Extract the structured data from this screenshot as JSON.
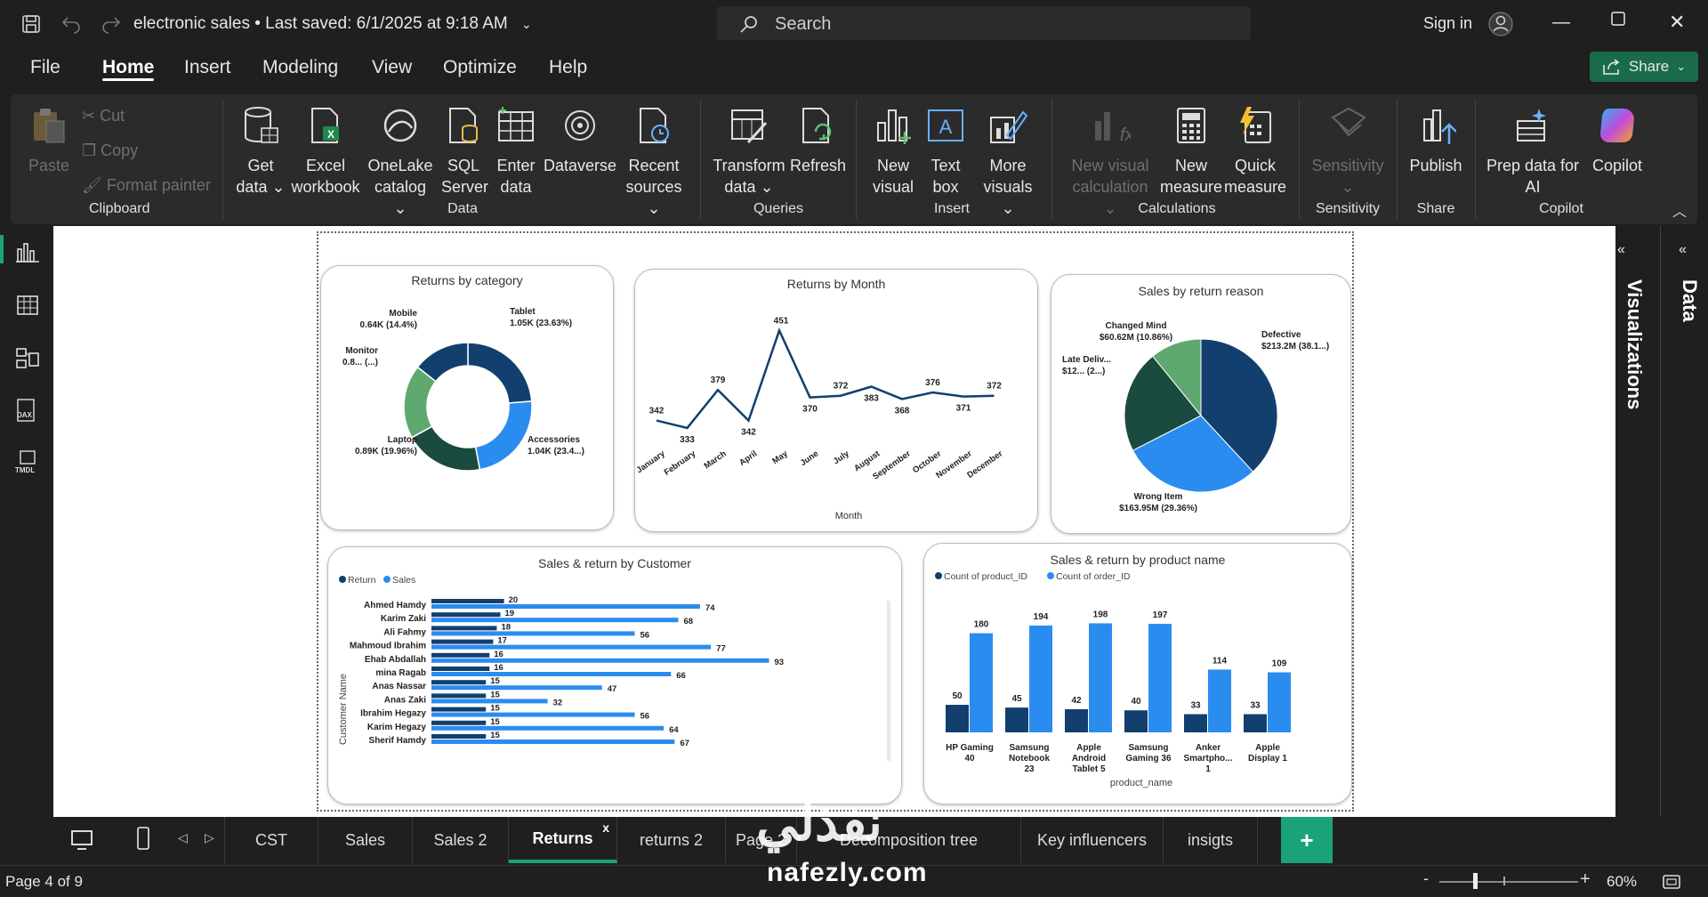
{
  "titlebar": {
    "doc_title": "electronic sales",
    "saved_text": "Last saved: 6/1/2025 at 9:18 AM",
    "search_placeholder": "Search",
    "signin": "Sign in"
  },
  "menu": [
    "File",
    "Home",
    "Insert",
    "Modeling",
    "View",
    "Optimize",
    "Help"
  ],
  "share_label": "Share",
  "ribbon": {
    "clipboard": {
      "paste": "Paste",
      "cut": "Cut",
      "copy": "Copy",
      "format_painter": "Format painter",
      "group": "Clipboard"
    },
    "data": {
      "get_data": [
        "Get",
        "data"
      ],
      "excel": [
        "Excel",
        "workbook"
      ],
      "onelake": [
        "OneLake",
        "catalog"
      ],
      "sql": [
        "SQL",
        "Server"
      ],
      "enter": [
        "Enter",
        "data"
      ],
      "dataverse": "Dataverse",
      "recent": [
        "Recent",
        "sources"
      ],
      "group": "Data"
    },
    "queries": {
      "transform": [
        "Transform",
        "data"
      ],
      "refresh": "Refresh",
      "group": "Queries"
    },
    "insert": {
      "new_visual": [
        "New",
        "visual"
      ],
      "text_box": [
        "Text",
        "box"
      ],
      "more_visuals": [
        "More",
        "visuals"
      ],
      "group": "Insert"
    },
    "calculations": {
      "new_visual_calc": [
        "New visual",
        "calculation"
      ],
      "new_measure": [
        "New",
        "measure"
      ],
      "quick_measure": [
        "Quick",
        "measure"
      ],
      "group": "Calculations"
    },
    "sensitivity": {
      "btn": "Sensitivity",
      "group": "Sensitivity"
    },
    "share": {
      "publish": "Publish",
      "group": "Share"
    },
    "copilot": {
      "prep": [
        "Prep data for",
        "AI"
      ],
      "copilot": "Copilot",
      "group": "Copilot"
    }
  },
  "right_pane": {
    "visualizations": "Visualizations",
    "data": "Data"
  },
  "tabs": [
    "CST",
    "Sales",
    "Sales 2",
    "Returns",
    "returns 2",
    "Page 2",
    "Decomposition tree",
    "Key influencers",
    "insigts"
  ],
  "tab_close": "x",
  "tab_add": "+",
  "status": {
    "page": "Page 4 of 9",
    "zoom": "60%",
    "minus": "-",
    "plus": "+"
  },
  "watermark": {
    "arabic": "نفذلي",
    "url": "nafezly.com"
  },
  "colors": {
    "dark_navy": "#123f6e",
    "bright_blue": "#2b8cf0",
    "dark_green": "#1b4a3e",
    "light_green": "#5fa970",
    "share_green": "#1a6b4a",
    "tab_active": "#1aa37a"
  },
  "chart_data": [
    {
      "type": "pie",
      "variant": "donut",
      "title": "Returns by category",
      "slices": [
        {
          "name": "Tablet",
          "label": "1.05K (23.63%)",
          "value": 23.63,
          "color": "#123f6e"
        },
        {
          "name": "Accessories",
          "label": "1.04K (23.4...)",
          "value": 23.4,
          "color": "#2b8cf0"
        },
        {
          "name": "Laptop",
          "label": "0.89K (19.96%)",
          "value": 19.96,
          "color": "#1b4a3e"
        },
        {
          "name": "Monitor",
          "label": "0.8... (...)",
          "value": 18.6,
          "color": "#5fa970"
        },
        {
          "name": "Mobile",
          "label": "0.64K (14.4%)",
          "value": 14.4,
          "color": "#123f6e"
        }
      ]
    },
    {
      "type": "line",
      "title": "Returns by Month",
      "xlabel": "Month",
      "categories": [
        "January",
        "February",
        "March",
        "April",
        "May",
        "June",
        "July",
        "August",
        "September",
        "October",
        "November",
        "December"
      ],
      "values": [
        342,
        333,
        379,
        342,
        451,
        370,
        372,
        383,
        368,
        376,
        371,
        372
      ],
      "ylim": [
        320,
        460
      ]
    },
    {
      "type": "pie",
      "title": "Sales by return reason",
      "slices": [
        {
          "name": "Defective",
          "label": "$213.2M (38.1...)",
          "value": 38.1,
          "color": "#123f6e"
        },
        {
          "name": "Wrong Item",
          "label": "$163.95M (29.36%)",
          "value": 29.36,
          "color": "#2b8cf0"
        },
        {
          "name": "Late Deliv...",
          "label": "$12... (2...)",
          "value": 21.68,
          "color": "#1b4a3e"
        },
        {
          "name": "Changed Mind",
          "label": "$60.62M (10.86%)",
          "value": 10.86,
          "color": "#5fa970"
        }
      ]
    },
    {
      "type": "bar",
      "orientation": "horizontal",
      "title": "Sales & return by Customer",
      "ylabel": "Customer Name",
      "categories": [
        "Ahmed Hamdy",
        "Karim Zaki",
        "Ali Fahmy",
        "Mahmoud Ibrahim",
        "Ehab Abdallah",
        "mina Ragab",
        "Anas Nassar",
        "Anas Zaki",
        "Ibrahim Hegazy",
        "Karim Hegazy",
        "Sherif Hamdy"
      ],
      "series": [
        {
          "name": "Return",
          "color": "#123f6e",
          "values": [
            20,
            19,
            18,
            17,
            16,
            16,
            15,
            15,
            15,
            15,
            15
          ]
        },
        {
          "name": "Sales",
          "color": "#2b8cf0",
          "values": [
            74,
            68,
            56,
            77,
            93,
            66,
            47,
            32,
            56,
            64,
            67
          ]
        }
      ],
      "xlim": [
        0,
        100
      ]
    },
    {
      "type": "bar",
      "title": "Sales & return by product name",
      "xlabel": "product_name",
      "categories": [
        [
          "HP Gaming",
          "40"
        ],
        [
          "Samsung",
          "Notebook",
          "23"
        ],
        [
          "Apple",
          "Android",
          "Tablet 5"
        ],
        [
          "Samsung",
          "Gaming 36"
        ],
        [
          "Anker",
          "Smartpho...",
          "1"
        ],
        [
          "Apple",
          "Display 1"
        ]
      ],
      "series": [
        {
          "name": "Count of product_ID",
          "color": "#123f6e",
          "values": [
            50,
            45,
            42,
            40,
            33,
            33
          ]
        },
        {
          "name": "Count of order_ID",
          "color": "#2b8cf0",
          "values": [
            180,
            194,
            198,
            197,
            114,
            109
          ]
        }
      ],
      "ylim": [
        0,
        210
      ]
    }
  ]
}
